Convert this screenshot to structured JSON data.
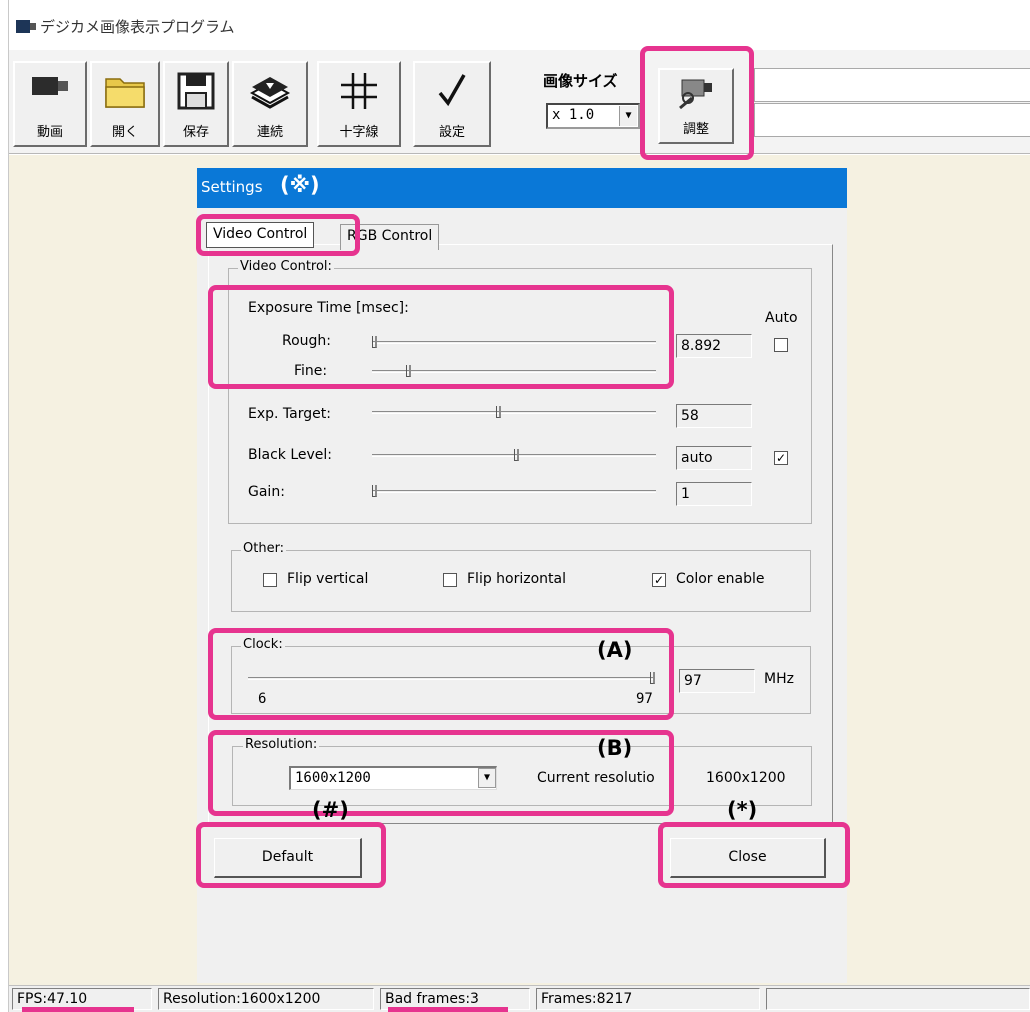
{
  "window": {
    "title": "デジカメ画像表示プログラム"
  },
  "toolbar": {
    "buttons": [
      {
        "label": "動画",
        "icon": "video-camera-icon"
      },
      {
        "label": "開く",
        "icon": "folder-icon"
      },
      {
        "label": "保存",
        "icon": "floppy-disk-icon"
      },
      {
        "label": "連続",
        "icon": "stacked-photos-icon"
      },
      {
        "label": "十字線",
        "icon": "crosshair-grid-icon"
      },
      {
        "label": "設定",
        "icon": "checkmark-icon"
      },
      {
        "label": "調整",
        "icon": "camera-adjust-icon"
      }
    ],
    "image_size_label": "画像サイズ",
    "image_size_value": "x 1.0",
    "info_line1": "",
    "info_line2": ""
  },
  "dialog": {
    "title": "Settings",
    "title_mark": "(※)",
    "tabs": [
      {
        "label": "Video Control",
        "active": true
      },
      {
        "label": "RGB Control",
        "active": false
      }
    ],
    "video_control": {
      "group_label": "Video Control:",
      "exposure_label": "Exposure Time [msec]:",
      "auto_label": "Auto",
      "rough_label": "Rough:",
      "fine_label": "Fine:",
      "exposure_value": "8.892",
      "auto_checked": false,
      "exp_target_label": "Exp. Target:",
      "exp_target_value": "58",
      "black_level_label": "Black Level:",
      "black_level_value": "auto",
      "black_level_auto_checked": true,
      "gain_label": "Gain:",
      "gain_value": "1",
      "slider_levels": {
        "rough": 0.0,
        "fine": 0.12,
        "exp_target": 0.44,
        "black_level": 0.5,
        "gain": 0.0
      }
    },
    "other": {
      "group_label": "Other:",
      "flip_vertical_label": "Flip vertical",
      "flip_vertical_checked": false,
      "flip_horizontal_label": "Flip horizontal",
      "flip_horizontal_checked": false,
      "color_enable_label": "Color enable",
      "color_enable_checked": true
    },
    "clock": {
      "group_label": "Clock:",
      "min": "6",
      "max": "97",
      "value": "97",
      "unit": "MHz",
      "slider_level": 1.0
    },
    "resolution": {
      "group_label": "Resolution:",
      "selected": "1600x1200",
      "current_label": "Current resolutio",
      "current_value": "1600x1200"
    },
    "default_button": "Default",
    "close_button": "Close"
  },
  "annotations": {
    "a": "(A)",
    "b": "(B)",
    "hash": "(#)",
    "asterisk": "(*)"
  },
  "status": {
    "fps": "FPS:47.10",
    "resolution": "Resolution:1600x1200",
    "bad_frames": "Bad frames:3",
    "frames": "Frames:8217"
  },
  "colors": {
    "highlight": "#e6348f",
    "titlebar": "#0a78d7",
    "client_bg": "#f5f1e1"
  }
}
